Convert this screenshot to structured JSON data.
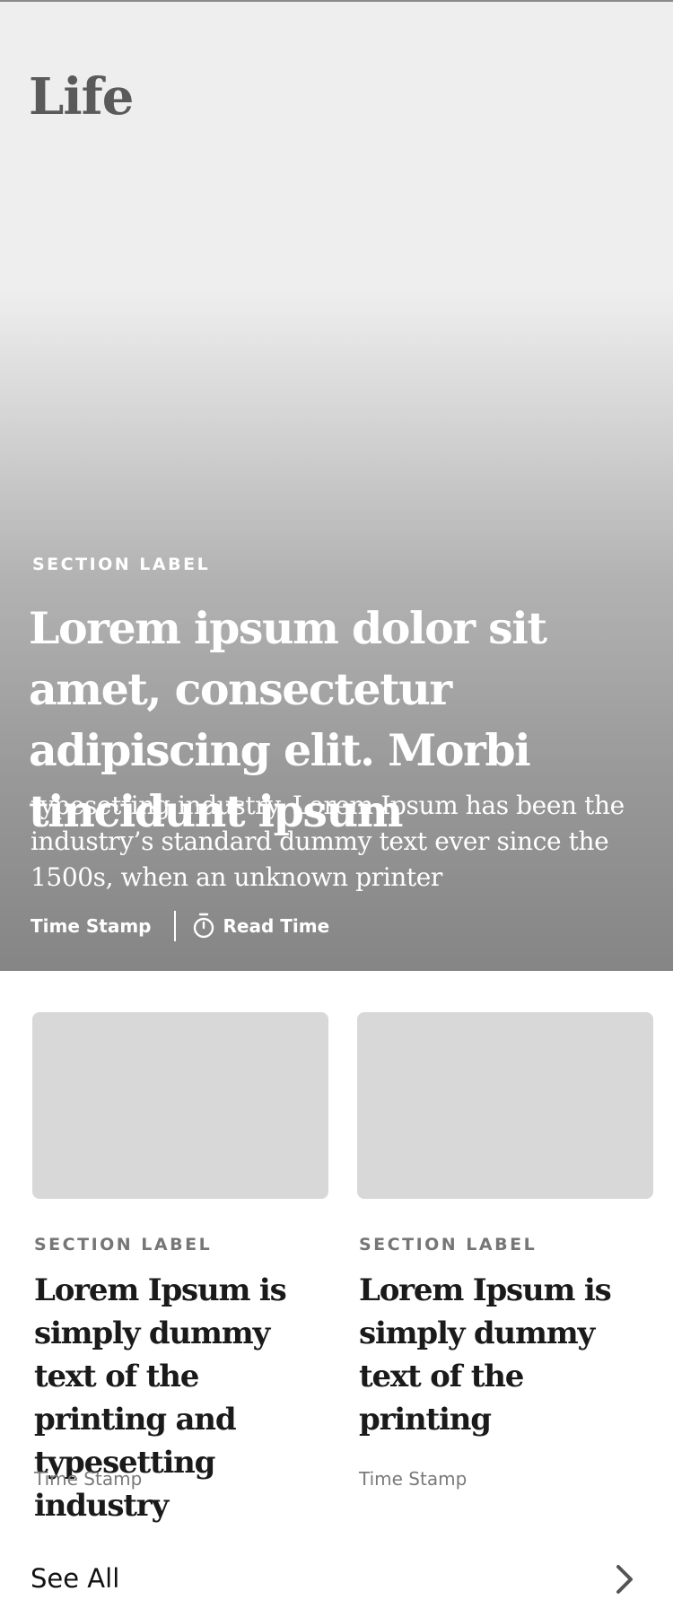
{
  "page": {
    "title": "Life"
  },
  "hero": {
    "section_label": "SECTION LABEL",
    "headline": "Lorem ipsum dolor sit amet, consectetur adipiscing elit. Morbi tincidunt ipsum",
    "summary": "typesetting industry. Lorem Ipsum has been the industry’s standard dummy text ever since the 1500s, when an unknown printer",
    "timestamp": "Time Stamp",
    "read_time": "Read Time",
    "read_time_icon": "stopwatch-icon"
  },
  "cards": [
    {
      "section_label": "SECTION LABEL",
      "title": "Lorem Ipsum is simply dummy text of the printing and typesetting industry",
      "timestamp": "Time Stamp"
    },
    {
      "section_label": "SECTION LABEL",
      "title": "Lorem Ipsum is simply dummy text of the printing",
      "timestamp": "Time Stamp"
    }
  ],
  "footer": {
    "see_all_label": "See All",
    "see_all_icon": "chevron-right-icon"
  },
  "colors": {
    "hero_top": "#eeeeee",
    "hero_bottom": "#858585",
    "image_placeholder": "#d8d8d8",
    "label_gray": "#767676",
    "title_text": "#1a1a1a"
  }
}
